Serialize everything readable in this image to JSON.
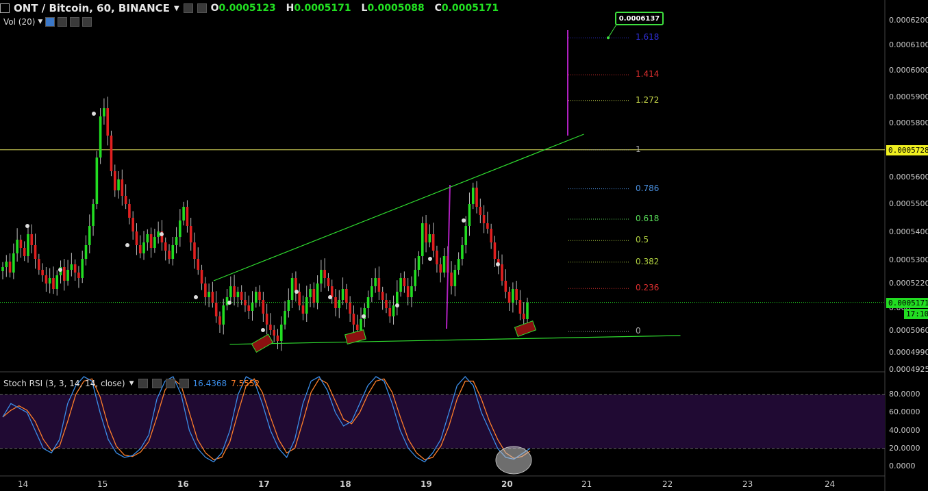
{
  "header": {
    "symbol": "ONT / Bitcoin, 60, BINANCE",
    "ohlc": [
      {
        "k": "O",
        "v": "0.0005123"
      },
      {
        "k": "H",
        "v": "0.0005171"
      },
      {
        "k": "L",
        "v": "0.0005088"
      },
      {
        "k": "C",
        "v": "0.0005171"
      }
    ],
    "volume_label": "Vol (20)"
  },
  "rsi_header": {
    "label": "Stoch RSI (3, 3, 14, 14, close)",
    "k_value": "16.4368",
    "d_value": "7.5552",
    "k_color": "#3b8de8",
    "d_color": "#ff7f2a"
  },
  "colors": {
    "up": "#22dd22",
    "down": "#e02020",
    "fib_blue": "#3030d8",
    "fib_red": "#e03030",
    "fib_yellow": "#c8d84a",
    "fib_gray": "#aaaaaa",
    "fib_lightblue": "#4a90e0",
    "fib_green": "#5ae05a",
    "fib_olive": "#b0d040",
    "rsi_band": "#200a33"
  },
  "chart_data": {
    "type": "candlestick",
    "price_axis": {
      "ticks": [
        "0.0006200",
        "0.0006100",
        "0.0006000",
        "0.0005900",
        "0.0005800",
        "0.0005700",
        "0.0005600",
        "0.0005500",
        "0.0005400",
        "0.0005300",
        "0.0005220",
        "0.000",
        "0.0005060",
        "0.0004990",
        "0.0004925"
      ],
      "current_price_label": "0.0005171",
      "countdown": "17:10",
      "horizontal_level_label": "0.0005728",
      "target_callout": "0.0006137"
    },
    "time_axis": {
      "ticks": [
        "14",
        "15",
        "16",
        "17",
        "18",
        "19",
        "20",
        "21",
        "22",
        "23",
        "24"
      ]
    },
    "fib_levels": [
      {
        "label": "1.618",
        "price": 0.0006137,
        "color": "#3030d8"
      },
      {
        "label": "1.414",
        "price": 0.0006002,
        "color": "#e03030"
      },
      {
        "label": "1.272",
        "price": 0.0005908,
        "color": "#c8d84a"
      },
      {
        "label": "1",
        "price": 0.0005728,
        "color": "#aaaaaa"
      },
      {
        "label": "0.786",
        "price": 0.0005586,
        "color": "#4a90e0"
      },
      {
        "label": "0.618",
        "price": 0.0005475,
        "color": "#5ae05a"
      },
      {
        "label": "0.5",
        "price": 0.0005397,
        "color": "#b0d040"
      },
      {
        "label": "0.382",
        "price": 0.0005318,
        "color": "#b0d040"
      },
      {
        "label": "0.236",
        "price": 0.0005222,
        "color": "#e03030"
      },
      {
        "label": "0",
        "price": 0.0005065,
        "color": "#aaaaaa"
      }
    ],
    "candles_close": [
      0.00053,
      0.000532,
      0.000528,
      0.000535,
      0.00054,
      0.000537,
      0.000534,
      0.000542,
      0.000538,
      0.000533,
      0.000529,
      0.000527,
      0.000524,
      0.000526,
      0.000522,
      0.000527,
      0.00053,
      0.000525,
      0.000529,
      0.000531,
      0.000528,
      0.000526,
      0.000533,
      0.000538,
      0.000545,
      0.000553,
      0.00057,
      0.000585,
      0.000588,
      0.000578,
      0.000565,
      0.000558,
      0.000562,
      0.000556,
      0.000553,
      0.000548,
      0.000543,
      0.000538,
      0.000535,
      0.000539,
      0.000542,
      0.000537,
      0.000541,
      0.000543,
      0.000539,
      0.000536,
      0.000533,
      0.000538,
      0.000541,
      0.000547,
      0.000552,
      0.000545,
      0.000539,
      0.000533,
      0.000529,
      0.000524,
      0.000519,
      0.000521,
      0.000517,
      0.000512,
      0.000509,
      0.000516,
      0.000519,
      0.000523,
      0.000519,
      0.000521,
      0.000518,
      0.000516,
      0.000514,
      0.000517,
      0.000521,
      0.000518,
      0.000513,
      0.000509,
      0.000507,
      0.000505,
      0.000503,
      0.000509,
      0.000514,
      0.000518,
      0.000526,
      0.000521,
      0.000516,
      0.000513,
      0.000519,
      0.000522,
      0.000517,
      0.000524,
      0.000529,
      0.000526,
      0.000523,
      0.000519,
      0.000515,
      0.000518,
      0.000522,
      0.000517,
      0.000513,
      0.000509,
      0.000507,
      0.000511,
      0.000515,
      0.000519,
      0.000523,
      0.000526,
      0.000521,
      0.000518,
      0.000515,
      0.000512,
      0.000516,
      0.000521,
      0.000526,
      0.000523,
      0.000519,
      0.000523,
      0.000529,
      0.000534,
      0.000546,
      0.000539,
      0.000542,
      0.000536,
      0.000531,
      0.000528,
      0.000534,
      0.000528,
      0.000523,
      0.000529,
      0.000533,
      0.000538,
      0.000545,
      0.000553,
      0.000559,
      0.000552,
      0.000549,
      0.000546,
      0.000544,
      0.000539,
      0.000533,
      0.000531,
      0.000525,
      0.000521,
      0.000517,
      0.000522,
      0.000518,
      0.000513,
      0.000511,
      0.000517
    ],
    "trendlines": [
      {
        "name": "upper",
        "from": [
          "16.4",
          0.000525
        ],
        "to": [
          "21.0",
          0.0005785
        ]
      },
      {
        "name": "lower",
        "from": [
          "16.6",
          0.0005018
        ],
        "to": [
          "22.2",
          0.000505
        ]
      }
    ],
    "horizontal_line": 0.0005728,
    "stoch_rsi": {
      "ticks": [
        "80.0000",
        "60.0000",
        "40.0000",
        "20.0000",
        "0.0000"
      ],
      "band": [
        20,
        80
      ]
    }
  }
}
